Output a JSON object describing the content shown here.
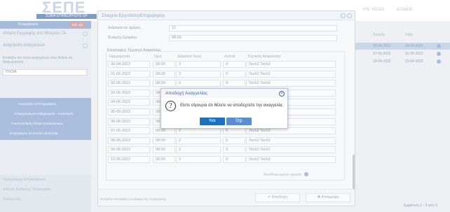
{
  "header": {
    "logo_text": "ΣΕΠΕ",
    "logo_subtitle": "ΣΩΜΑ ΕΠΙΘΕΩΡΗΣΗΣ ΕΡ",
    "user_label": "PTL-TECH2",
    "logout_label": "ΕΞΟΔΟΣ"
  },
  "sidebar": {
    "head_label": "Επιχείρηση",
    "head_badge": "Ειδ. ειδ.",
    "link_1": "Αίτηση Εγγραφής στο Μητρώο ΤΑ",
    "link_2": "Διαχείριση Αναγγελιών",
    "helper_text": "Επιλέξτε τον τύπο αναγγελιών που θέλετε να διαχειριστείτε",
    "select_value": "ΠΛΟΙΑ",
    "menu": [
      "Αναγγελίες σε Επιχειρήσεις",
      "Απασχολούμενοι Πληρώματα - Απόσπαση",
      "Γνωστοποίηση Πλοίου Εναλλακτικών",
      "Επιχειρήσεις σε Εκτελεί Ιδιοκτησία"
    ],
    "bottom_1": "Πρόγραμμα Επισκέψεων",
    "bottom_2": "Αίτηση Διάθεσης Ιδιοκτησίας",
    "bottom_3": "Αναγγελίες"
  },
  "main": {
    "col_start": "Έναρξη",
    "col_end": "Λήξη",
    "rows": [
      {
        "start": "30-04-2022",
        "end": "10-05-2022"
      },
      {
        "start": "27-05-2022",
        "end": "31-05-2022"
      },
      {
        "start": "19-04-2022",
        "end": "23-04-2022"
      }
    ],
    "footer_left": "Σελίδα 1 από 1",
    "footer_right": "Εμφάνιση 1 - 3 από 3"
  },
  "window": {
    "title": "Στοιχεία Εργοδότη/Επιχείρησης",
    "fields": [
      {
        "label": "Διάρκεια σε ημέρες",
        "value": "11"
      },
      {
        "label": "Έναρξη Ωραρίου",
        "value": "08:00"
      }
    ],
    "section_title": "Επισκέψεις Τεχνικού Ασφαλείας",
    "table_headers": [
      "Ημερομηνία",
      "Ώρα",
      "Διάρκεια Ώρες",
      "Λεπτά",
      "Τεχνικός Ασφαλείας"
    ],
    "table_rows": [
      [
        "30-04-2022",
        "08:00",
        "2",
        "0",
        "Tech2 Tech2"
      ],
      [
        "01-05-2022",
        "08:00",
        "2",
        "0",
        "Tech2 Tech2"
      ],
      [
        "02-05-2022",
        "08:00",
        "2",
        "0",
        "Tech2 Tech2"
      ],
      [
        "03-05-2022",
        "08:00",
        "2",
        "0",
        "Tech2 Tech2"
      ],
      [
        "04-05-2022",
        "08:00",
        "2",
        "0",
        "Tech2 Tech2"
      ],
      [
        "05-05-2022",
        "08:00",
        "2",
        "0",
        "Tech2 Tech2"
      ],
      [
        "06-05-2022",
        "08:00",
        "2",
        "0",
        "Tech2 Tech2"
      ],
      [
        "07-05-2022",
        "08:00",
        "2",
        "0",
        "Tech2 Tech2"
      ],
      [
        "08-05-2022",
        "08:00",
        "2",
        "0",
        "Tech2 Tech2"
      ],
      [
        "09-05-2022",
        "08:00",
        "2",
        "0",
        "Tech2 Tech2"
      ],
      [
        "10-05-2022",
        "08:00",
        "2",
        "0",
        "Tech2 Tech2"
      ]
    ],
    "add_label": "Αποθηκευμένα αρχεία",
    "footer_text": "*Επιλέξτε επισκέψη ή ανάληψη της επιχείρησης",
    "accept_label": "✔ Αποδοχή",
    "reject_label": "✖ Απόρριψη"
  },
  "modal": {
    "title": "Αποδοχή Αναγγελίας",
    "message": "Είστε σίγουροι ότι θέλετε να αποδεχτείτε την αναγγελία;",
    "yes_label": "Ναι",
    "no_label": "Όχι"
  },
  "colors": {
    "accent": "#1e6fc2",
    "accent_light": "#5b8ed1",
    "title_text": "#3f67a8"
  }
}
